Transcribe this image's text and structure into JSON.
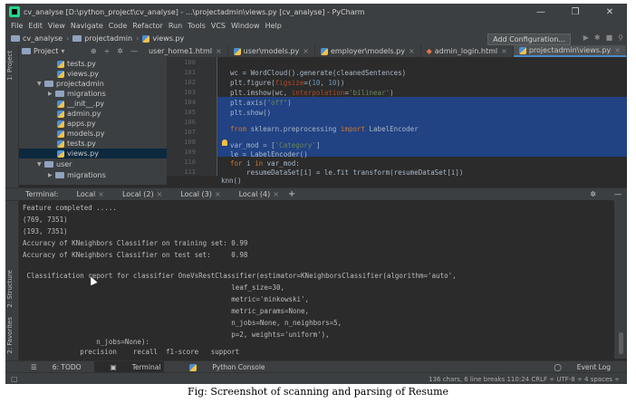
{
  "window": {
    "title": "cv_analyse [D:\\python_project\\cv_analyse] - ...\\projectadmin\\views.py [cv_analyse] - PyCharm",
    "controls": [
      "—",
      "❐",
      "✕"
    ]
  },
  "menu": [
    "File",
    "Edit",
    "View",
    "Navigate",
    "Code",
    "Refactor",
    "Run",
    "Tools",
    "VCS",
    "Window",
    "Help"
  ],
  "breadcrumb": [
    "cv_analyse",
    "projectadmin",
    "views.py"
  ],
  "toolbar": {
    "add_config": "Add Configuration..."
  },
  "project_panel": {
    "header": "Project",
    "tree": [
      {
        "label": "tests.py",
        "kind": "py"
      },
      {
        "label": "views.py",
        "kind": "py"
      },
      {
        "label": "projectadmin",
        "kind": "folder"
      },
      {
        "label": "migrations",
        "kind": "folder"
      },
      {
        "label": "__init__.py",
        "kind": "py"
      },
      {
        "label": "admin.py",
        "kind": "py"
      },
      {
        "label": "apps.py",
        "kind": "py"
      },
      {
        "label": "models.py",
        "kind": "py"
      },
      {
        "label": "tests.py",
        "kind": "py"
      },
      {
        "label": "views.py",
        "kind": "py",
        "selected": true
      },
      {
        "label": "user",
        "kind": "folder"
      },
      {
        "label": "migrations",
        "kind": "folder"
      }
    ]
  },
  "editor_tabs": [
    {
      "label": "user_home1.html"
    },
    {
      "label": "user\\models.py"
    },
    {
      "label": "employer\\models.py"
    },
    {
      "label": "admin_login.html"
    },
    {
      "label": "projectadmin\\views.py",
      "active": true
    }
  ],
  "editor": {
    "line_numbers": [
      "100",
      "101",
      "102",
      "103",
      "104",
      "105",
      "106",
      "107",
      "108",
      "109",
      "110",
      "111",
      "112"
    ],
    "footer_symbol": "knn()"
  },
  "terminal": {
    "tabs": [
      "Terminal:",
      "Local",
      "Local (2)",
      "Local (3)",
      "Local (4)",
      "+"
    ],
    "lines": [
      "Feature completed .....",
      "(769, 7351)",
      "(193, 7351)",
      "Accuracy of KNeighbors Classifier on training set: 0.99",
      "Accuracy of KNeighbors Classifier on test set:     0.98",
      "",
      " Classification report for classifier OneVsRestClassifier(estimator=KNeighborsClassifier(algorithm='auto',",
      "                                                   leaf_size=30,",
      "                                                   metric='minkowski',",
      "                                                   metric_params=None,",
      "                                                   n_jobs=None, n_neighbors=5,",
      "                                                   p=2, weights='uniform'),",
      "",
      "                  n_jobs=None):",
      "              precision    recall  f1-score   support"
    ]
  },
  "left_tool_labels": [
    "1: Project",
    "2: Structure",
    "2: Favorites"
  ],
  "bottom_tools": [
    "6: TODO",
    "Terminal",
    "Python Console"
  ],
  "event_log": "Event Log",
  "status": "136 chars, 6 line breaks   110:24   CRLF ÷   UTF-8 ÷   4 spaces ÷",
  "caption": "Fig: Screenshot of scanning and parsing of Resume"
}
